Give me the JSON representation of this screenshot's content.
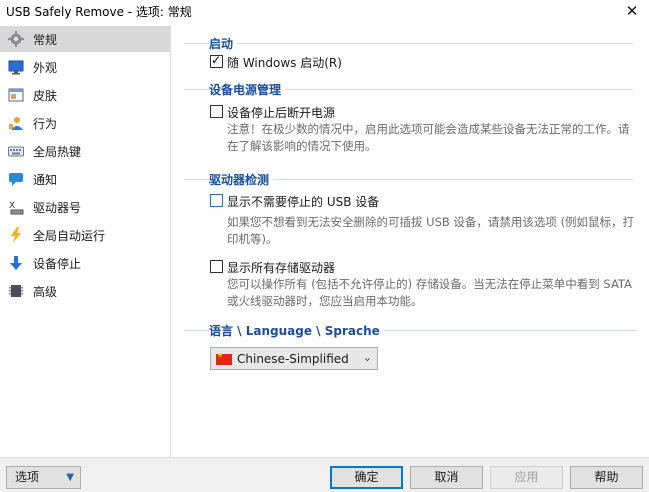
{
  "window": {
    "title": "USB Safely Remove - 选项: 常规",
    "close_glyph": "✕"
  },
  "sidebar": {
    "items": [
      {
        "label": "常规",
        "icon": "gear-icon"
      },
      {
        "label": "外观",
        "icon": "monitor-icon"
      },
      {
        "label": "皮肤",
        "icon": "window-skin-icon"
      },
      {
        "label": "行为",
        "icon": "person-icon"
      },
      {
        "label": "全局热键",
        "icon": "keyboard-icon"
      },
      {
        "label": "通知",
        "icon": "speech-bubble-icon"
      },
      {
        "label": "驱动器号",
        "icon": "drive-letter-icon"
      },
      {
        "label": "全局自动运行",
        "icon": "lightning-icon"
      },
      {
        "label": "设备停止",
        "icon": "down-arrow-icon"
      },
      {
        "label": "高级",
        "icon": "chip-icon"
      }
    ]
  },
  "startup": {
    "title": "启动",
    "run_with_windows_label": "随 Windows 启动(R)",
    "run_with_windows_checked": true
  },
  "power": {
    "title": "设备电源管理",
    "power_off_label": "设备停止后断开电源",
    "power_off_checked": false,
    "note": "注意！在极少数的情况中，启用此选项可能会造成某些设备无法正常的工作。请在了解该影响的情况下使用。"
  },
  "drive_detect": {
    "title": "驱动器检测",
    "show_unneeded_label": "显示不需要停止的 USB 设备",
    "show_unneeded_checked": false,
    "show_unneeded_note": "如果您不想看到无法安全删除的可插拔 USB 设备，请禁用该选项 (例如鼠标，打印机等)。",
    "show_all_label": "显示所有存储驱动器",
    "show_all_checked": false,
    "show_all_note": "您可以操作所有 (包括不允许停止的) 存储设备。当无法在停止菜单中看到 SATA 或火线驱动器时，您应当启用本功能。"
  },
  "language": {
    "title": "语言 \\ Language \\ Sprache",
    "selected": "Chinese-Simplified",
    "flag_color": "#de2910"
  },
  "footer": {
    "options_label": "选项",
    "ok_label": "确定",
    "cancel_label": "取消",
    "apply_label": "应用",
    "help_label": "帮助"
  },
  "colors": {
    "section_title": "#1b4f9b",
    "accent": "#0078d7",
    "active_nav": "#d9d9d9"
  }
}
